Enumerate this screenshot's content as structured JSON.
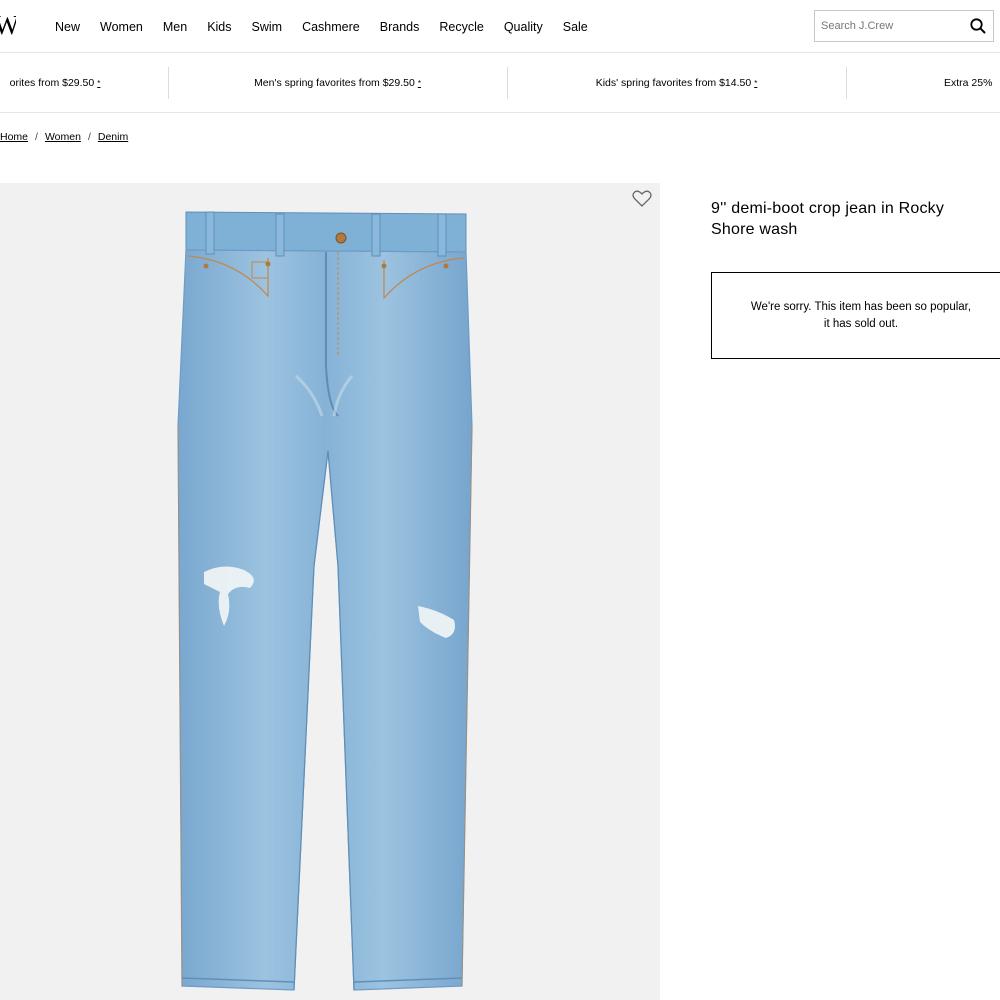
{
  "header": {
    "logo": "W",
    "nav": [
      "New",
      "Women",
      "Men",
      "Kids",
      "Swim",
      "Cashmere",
      "Brands",
      "Recycle",
      "Quality",
      "Sale"
    ],
    "search": {
      "placeholder": "Search J.Crew",
      "value": ""
    }
  },
  "promos": [
    "orites from $29.50",
    "Men's spring favorites from $29.50",
    "Kids' spring favorites from $14.50",
    "Extra 25%"
  ],
  "promo_mark": "*",
  "breadcrumb": [
    "Home",
    "Women",
    "Denim"
  ],
  "breadcrumb_sep": "/",
  "product": {
    "title": "9'' demi-boot crop jean in Rocky Shore wash",
    "soldout_line1": "We're sorry. This item has been so popular,",
    "soldout_line2": "it has sold out."
  },
  "colors": {
    "denim": "#8db7d8",
    "denim_dark": "#6d9cc4",
    "image_bg": "#f1f1f1"
  },
  "icons": {
    "wishlist": "heart-icon",
    "search": "search-icon"
  }
}
